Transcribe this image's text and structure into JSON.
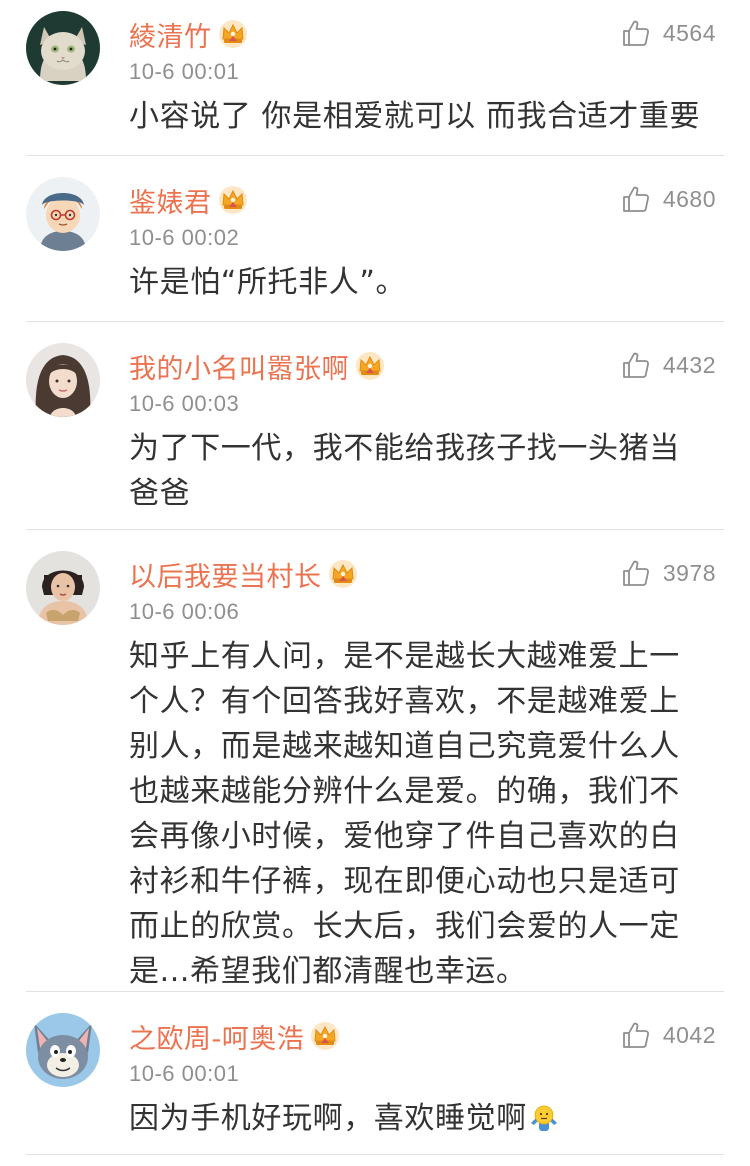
{
  "colors": {
    "name": "#eb7350",
    "meta": "#8f8f8f",
    "text": "#333333",
    "divider": "#e2e2e2",
    "crown": "#f5a623"
  },
  "comments": [
    {
      "avatar": "cat-avatar",
      "username": "綾清竹",
      "time": "10-6 00:01",
      "likes": "4564",
      "text": "小容说了 你是相爱就可以 而我合适才重要"
    },
    {
      "avatar": "cartoon-boy-avatar",
      "username": "鉴婊君",
      "time": "10-6 00:02",
      "likes": "4680",
      "text": "许是怕“所托非人”。"
    },
    {
      "avatar": "girl-photo-avatar",
      "username": "我的小名叫嚣张啊",
      "time": "10-6 00:03",
      "likes": "4432",
      "text": "为了下一代，我不能给我孩子找一头猪当爸爸"
    },
    {
      "avatar": "woman-photo-avatar",
      "username": "以后我要当村长",
      "time": "10-6 00:06",
      "likes": "3978",
      "text": "知乎上有人问，是不是越长大越难爱上一个人？有个回答我好喜欢，不是越难爱上别人，而是越来越知道自己究竟爱什么人 也越来越能分辨什么是爱。的确，我们不会再像小时候，爱他穿了件自己喜欢的白衬衫和牛仔裤，现在即便心动也只是适可而止的欣赏。长大后，我们会爱的人一定是...希望我们都清醒也幸运。"
    },
    {
      "avatar": "tom-cat-avatar",
      "username": "之欧周-呵奥浩",
      "time": "10-6 00:01",
      "likes": "4042",
      "text": "因为手机好玩啊，喜欢睡觉啊",
      "emoji": "shrug-emoji"
    }
  ]
}
